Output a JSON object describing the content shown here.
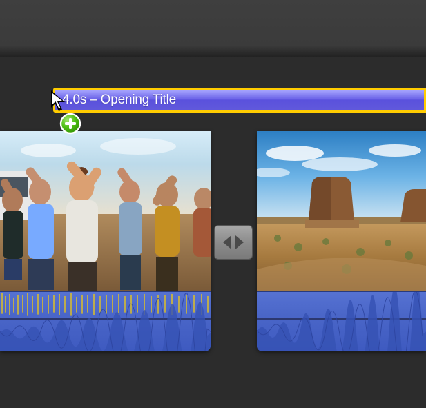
{
  "title_overlay": {
    "duration_text": "4.0s",
    "separator": " – ",
    "name": "Opening Title",
    "full_label": "4.0s – Opening Title",
    "border_color": "#ffcc00",
    "fill_top": "#a9a8ff",
    "fill_bottom": "#5a51dd"
  },
  "cursor": {
    "kind": "arrow",
    "badge": "add"
  },
  "icons": {
    "add": "plus-circle",
    "transition": "cross-dissolve"
  },
  "clips": [
    {
      "id": "clip-a",
      "description": "Group of people sitting outdoors, gesturing with hands",
      "has_audio": true,
      "audio_peak_style": "loud-yellow",
      "position": "left"
    },
    {
      "id": "clip-b",
      "description": "Desert landscape with rock butte and blue sky",
      "has_audio": true,
      "audio_peak_style": "quiet",
      "position": "right"
    }
  ],
  "transition": {
    "type": "cross-dissolve",
    "between": [
      "clip-a",
      "clip-b"
    ]
  },
  "colors": {
    "bg": "#2c2c2c",
    "bg_top": "#3f3f3f",
    "audio_track": "#4a66c8",
    "add_badge": "#3fb500"
  }
}
